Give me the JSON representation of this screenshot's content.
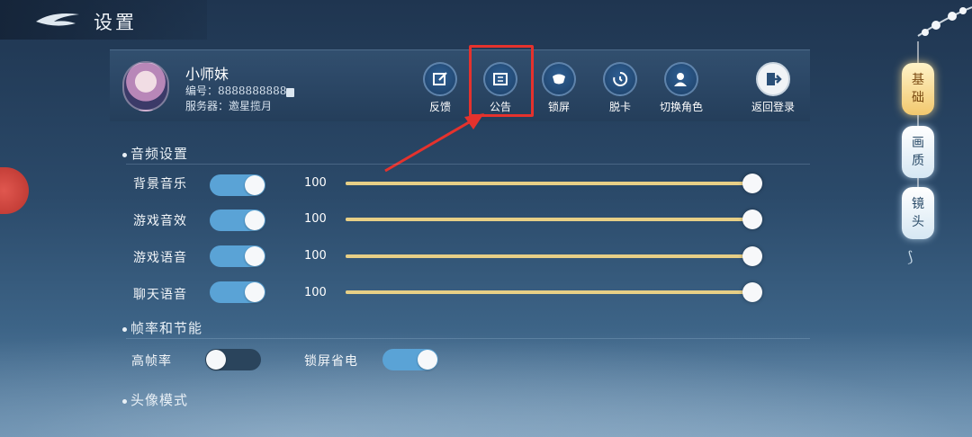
{
  "header": {
    "title": "设置",
    "logo_icon": "swoosh-logo"
  },
  "profile": {
    "name": "小师妹",
    "id_label": "编号：",
    "id_value": "8888888888",
    "server_label": "服务器：",
    "server_value": "邀星揽月",
    "avatar_icon": "character-portrait"
  },
  "toolbar": [
    {
      "label": "反馈",
      "icon": "feedback-edit-icon"
    },
    {
      "label": "公告",
      "icon": "announcement-icon"
    },
    {
      "label": "锁屏",
      "icon": "lock-screen-icon"
    },
    {
      "label": "脱卡",
      "icon": "unstuck-icon"
    },
    {
      "label": "切换角色",
      "icon": "switch-role-icon"
    },
    {
      "label": "返回登录",
      "icon": "logout-icon"
    }
  ],
  "audio_section": {
    "title": "音频设置",
    "rows": [
      {
        "label": "背景音乐",
        "enabled": true,
        "value": "100",
        "fraction": 1.0
      },
      {
        "label": "游戏音效",
        "enabled": true,
        "value": "100",
        "fraction": 1.0
      },
      {
        "label": "游戏语音",
        "enabled": true,
        "value": "100",
        "fraction": 1.0
      },
      {
        "label": "聊天语音",
        "enabled": true,
        "value": "100",
        "fraction": 1.0
      }
    ]
  },
  "framerate_section": {
    "title": "帧率和节能",
    "high_fps": {
      "label": "高帧率",
      "enabled": false
    },
    "lock_power_save": {
      "label": "锁屏省电",
      "enabled": true
    }
  },
  "avatar_section": {
    "title": "头像模式"
  },
  "side_tabs": [
    {
      "label": "基础",
      "active": true
    },
    {
      "label": "画质",
      "active": false
    },
    {
      "label": "镜头",
      "active": false
    }
  ],
  "colors": {
    "toggle_on": "#5aa3d6",
    "toggle_off": "#2a445c",
    "slider": "#d9c07a",
    "highlight": "#e5322d",
    "active_tab": "#f2c86e"
  }
}
